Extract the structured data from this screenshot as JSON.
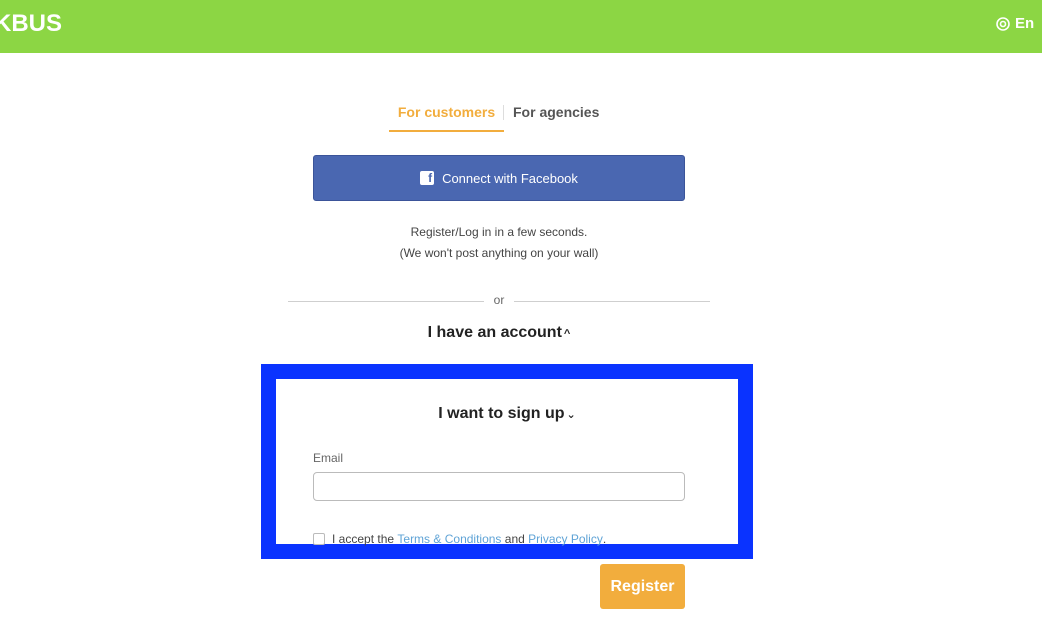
{
  "header": {
    "logo": "KBUS",
    "language_label": "En",
    "brand_color": "#8cd644"
  },
  "tabs": [
    {
      "label": "For customers",
      "active": true
    },
    {
      "label": "For agencies",
      "active": false
    }
  ],
  "facebook": {
    "button_label": "Connect with Facebook",
    "icon_glyph": "f",
    "note_line1": "Register/Log in in a few seconds.",
    "note_line2": "(We won't post anything on your wall)"
  },
  "divider": {
    "label": "or"
  },
  "login": {
    "title": "I have an account"
  },
  "signup": {
    "title": "I want to sign up",
    "email_label": "Email",
    "email_value": "",
    "accept_prefix": "I accept the",
    "terms_link": "Terms & Conditions",
    "and_text": "and",
    "privacy_link": "Privacy Policy",
    "period": ".",
    "highlight_color": "#0a33ff"
  },
  "register": {
    "label": "Register",
    "color": "#f2ad3d"
  }
}
